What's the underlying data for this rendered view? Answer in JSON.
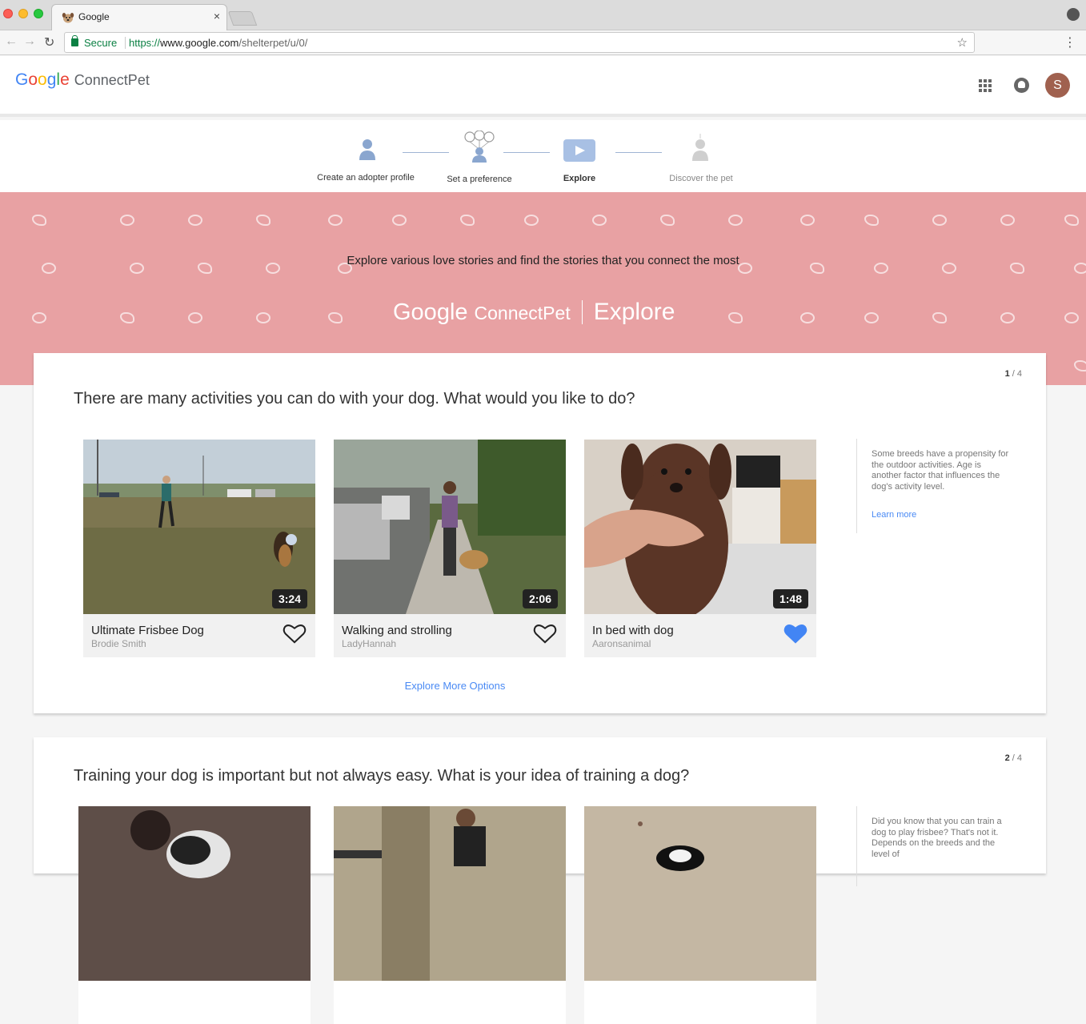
{
  "browser": {
    "tab_title": "Google",
    "tab_close": "×",
    "secure_label": "Secure",
    "url_scheme": "https://",
    "url_host": "www.google.com",
    "url_path": "/shelterpet/u/0/",
    "star_glyph": "☆",
    "menu_glyph": "⋮",
    "back_glyph": "←",
    "forward_glyph": "→",
    "reload_glyph": "↻"
  },
  "app": {
    "logo_letters": [
      "G",
      "o",
      "o",
      "g",
      "l",
      "e"
    ],
    "product_name": "ConnectPet",
    "avatar_initial": "S"
  },
  "stepper": {
    "steps": [
      {
        "label": "Create an adopter profile",
        "state": "done"
      },
      {
        "label": "Set a preference",
        "state": "done"
      },
      {
        "label": "Explore",
        "state": "active"
      },
      {
        "label": "Discover the pet",
        "state": "inactive"
      }
    ]
  },
  "hero": {
    "tagline": "Explore various love stories and find the stories that you connect the most",
    "brand_google": "Google",
    "brand_product": "ConnectPet",
    "brand_section": "Explore",
    "background_color": "#e8a1a3"
  },
  "questions": [
    {
      "counter_current": "1",
      "counter_total": " / 4",
      "text": "There are many activities you can do with your dog. What would you like to do?",
      "videos": [
        {
          "title": "Ultimate Frisbee Dog",
          "author": "Brodie Smith",
          "duration": "3:24",
          "liked": false
        },
        {
          "title": "Walking and strolling",
          "author": "LadyHannah",
          "duration": "2:06",
          "liked": false
        },
        {
          "title": "In bed with dog",
          "author": "Aaronsanimal",
          "duration": "1:48",
          "liked": true
        }
      ],
      "sidebar_text": "Some breeds have a propensity for the outdoor activities. Age is another factor that influences the dog's activity level.",
      "learn_more": "Learn more",
      "explore_more": "Explore More Options"
    },
    {
      "counter_current": "2",
      "counter_total": " / 4",
      "text": "Training your dog is important but not always easy. What is your idea of training a dog?",
      "sidebar_text": "Did you know that you can train a dog to play frisbee? That's not it. Depends on the breeds and the level of"
    }
  ],
  "colors": {
    "accent_blue": "#4285f4",
    "link_blue": "#4a8af4",
    "secure_green": "#0b8043"
  }
}
